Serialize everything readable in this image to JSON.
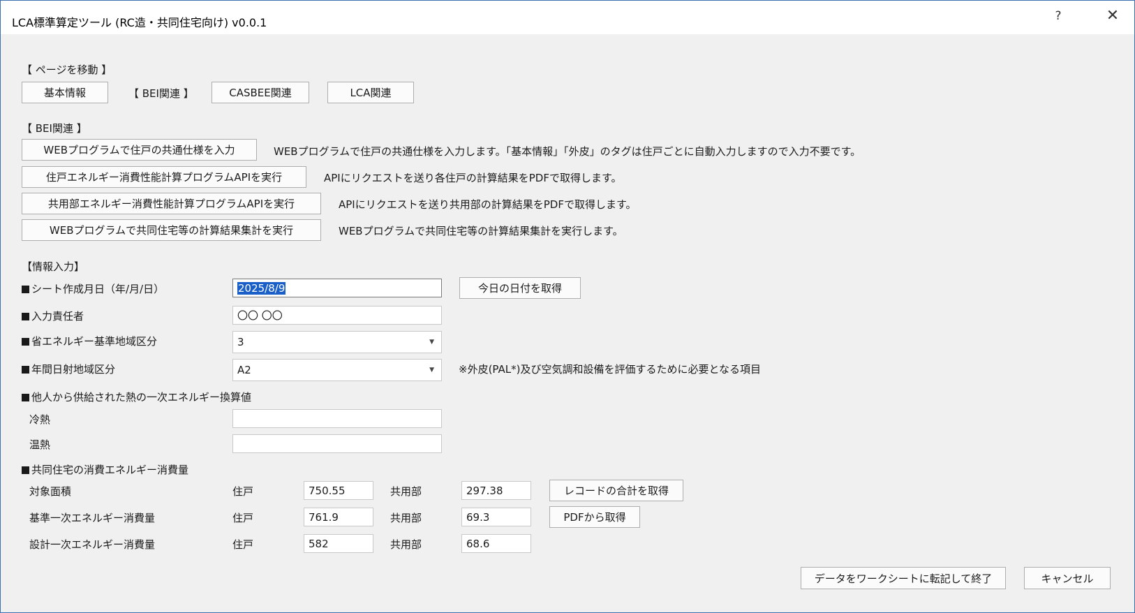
{
  "window": {
    "title": "LCA標準算定ツール (RC造・共同住宅向け) v0.0.1",
    "help_icon": "?",
    "close_icon": "✕"
  },
  "navigate": {
    "header": "【 ページを移動 】",
    "basic_info": "基本情報",
    "bei_current": "【  BEI関連  】",
    "casbee": "CASBEE関連",
    "lca": "LCA関連"
  },
  "bei": {
    "header": "【 BEI関連 】",
    "actions": [
      {
        "button": "WEBプログラムで住戸の共通仕様を入力",
        "desc": "WEBプログラムで住戸の共通仕様を入力します。「基本情報」「外皮」のタグは住戸ごとに自動入力しますので入力不要です。"
      },
      {
        "button": "住戸エネルギー消費性能計算プログラムAPIを実行",
        "desc": "APIにリクエストを送り各住戸の計算結果をPDFで取得します。"
      },
      {
        "button": "共用部エネルギー消費性能計算プログラムAPIを実行",
        "desc": "APIにリクエストを送り共用部の計算結果をPDFで取得します。"
      },
      {
        "button": "WEBプログラムで共同住宅等の計算結果集計を実行",
        "desc": "WEBプログラムで共同住宅等の計算結果集計を実行します。"
      }
    ]
  },
  "info": {
    "header": "【情報入力】",
    "sheet_date_label": "シート作成月日（年/月/日）",
    "sheet_date_value": "2025/8/9",
    "today_button": "今日の日付を取得",
    "person_label": "入力責任者",
    "person_value": "〇〇 〇〇",
    "energy_region_label": "省エネルギー基準地域区分",
    "energy_region_value": "3",
    "solar_region_label": "年間日射地域区分",
    "solar_region_value": "A2",
    "solar_note": "※外皮(PAL*)及び空気調和設備を評価するために必要となる項目",
    "heat_label": "他人から供給された熱の一次エネルギー換算値",
    "cold_label": "冷熱",
    "cold_value": "",
    "warm_label": "温熱",
    "warm_value": ""
  },
  "consumption": {
    "header": "共同住宅の消費エネルギー消費量",
    "rows": [
      {
        "label": "対象面積",
        "unit_label": "住戸",
        "unit_value": "750.55",
        "common_label": "共用部",
        "common_value": "297.38"
      },
      {
        "label": "基準一次エネルギー消費量",
        "unit_label": "住戸",
        "unit_value": "761.9",
        "common_label": "共用部",
        "common_value": "69.3"
      },
      {
        "label": "設計一次エネルギー消費量",
        "unit_label": "住戸",
        "unit_value": "582",
        "common_label": "共用部",
        "common_value": "68.6"
      }
    ],
    "sum_button": "レコードの合計を取得",
    "pdf_button": "PDFから取得"
  },
  "footer": {
    "ok_button": "データをワークシートに転記して終了",
    "cancel_button": "キャンセル"
  }
}
